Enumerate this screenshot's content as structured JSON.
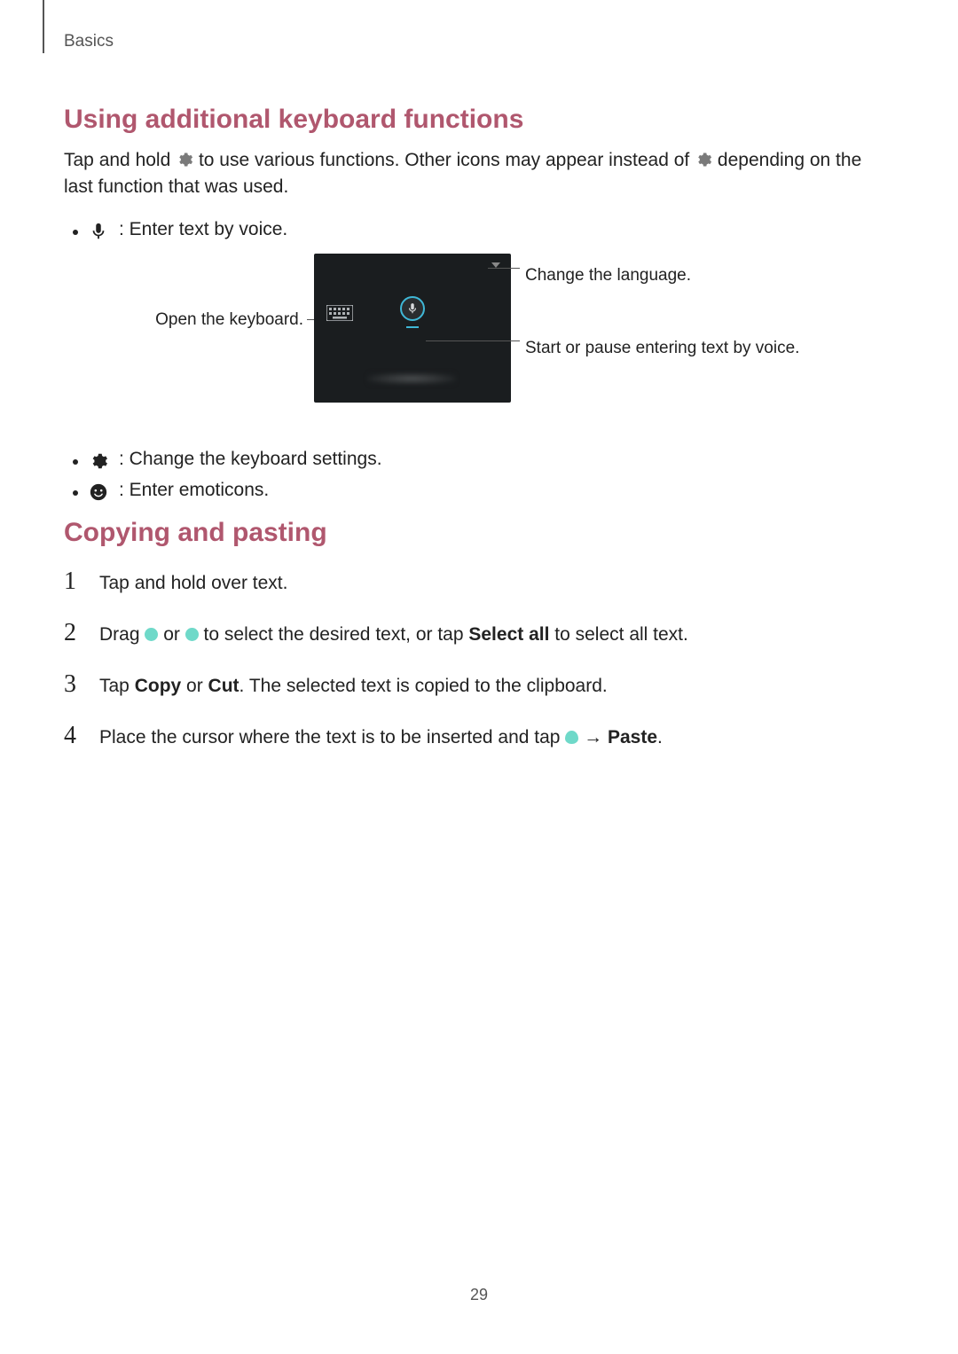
{
  "header": {
    "crumb": "Basics"
  },
  "section1": {
    "title": "Using additional keyboard functions",
    "intro_a": "Tap and hold ",
    "intro_b": " to use various functions. Other icons may appear instead of ",
    "intro_c": " depending on the last function that was used.",
    "bullets": {
      "voice": " : Enter text by voice.",
      "settings": " : Change the keyboard settings.",
      "emoticons": " : Enter emoticons."
    },
    "callouts": {
      "open_keyboard": "Open the keyboard.",
      "change_language": "Change the language.",
      "start_pause": "Start or pause entering text by voice."
    }
  },
  "section2": {
    "title": "Copying and pasting",
    "step1": "Tap and hold over text.",
    "step2_a": "Drag ",
    "step2_b": " or ",
    "step2_c": " to select the desired text, or tap ",
    "step2_d": "Select all",
    "step2_e": " to select all text.",
    "step3_a": "Tap ",
    "step3_b": "Copy",
    "step3_c": " or ",
    "step3_d": "Cut",
    "step3_e": ". The selected text is copied to the clipboard.",
    "step4_a": "Place the cursor where the text is to be inserted and tap ",
    "step4_b": " → ",
    "step4_c": "Paste",
    "step4_d": "."
  },
  "page_number": "29"
}
